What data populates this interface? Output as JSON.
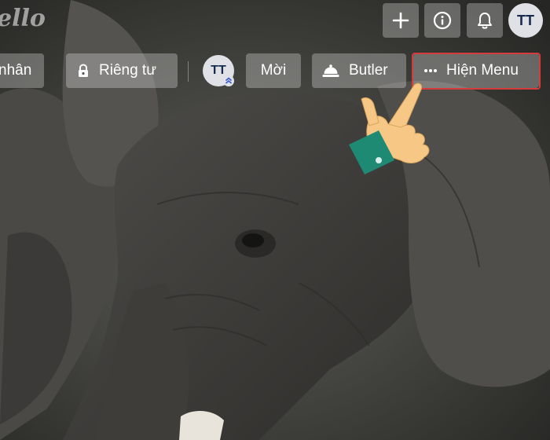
{
  "app": {
    "logo_text": "ello"
  },
  "header": {
    "add_label": "+",
    "avatar_initials": "TT"
  },
  "board_bar": {
    "personal_label": "nhân",
    "privacy_label": "Riêng tư",
    "member_initials": "TT",
    "invite_label": "Mời",
    "butler_label": "Butler",
    "show_menu_label": "Hiện Menu"
  },
  "icons": {
    "add": "plus-icon",
    "info": "info-icon",
    "notifications": "bell-icon",
    "privacy": "lock-icon",
    "butler": "butler-bell-icon",
    "menu": "ellipsis-icon",
    "admin": "chevron-up-double-icon",
    "pointer": "pointing-hand-icon"
  },
  "colors": {
    "highlight_border": "#d53b3b",
    "avatar_bg": "#dfe1e6",
    "avatar_text": "#172b4d",
    "cuff": "#1f8a74",
    "skin": "#f6c785"
  }
}
